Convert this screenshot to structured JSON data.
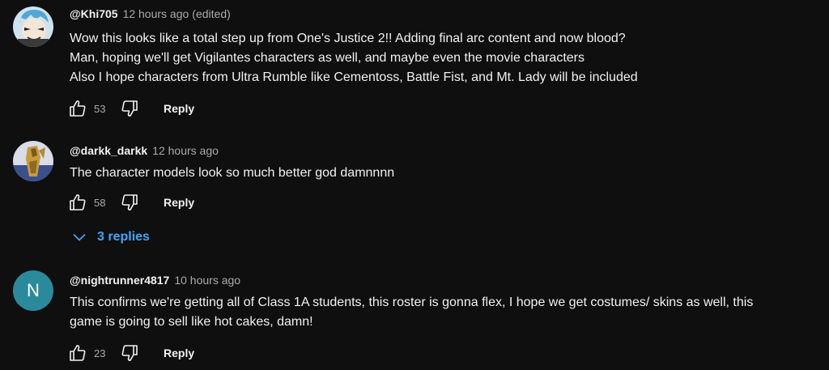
{
  "comments": [
    {
      "author": "@Khi705",
      "time": "12 hours ago",
      "edited": "(edited)",
      "avatar_icon": "anime-character-avatar-icon",
      "lines": [
        "Wow this looks like a total step up from One's Justice 2!! Adding final arc content and now blood?",
        "Man, hoping we'll get Vigilantes characters as well, and maybe even the movie characters",
        "Also I hope characters from Ultra Rumble like Cementoss, Battle Fist, and Mt. Lady will be included"
      ],
      "likes": "53",
      "reply_label": "Reply"
    },
    {
      "author": "@darkk_darkk",
      "time": "12 hours ago",
      "avatar_icon": "gold-figure-avatar-icon",
      "lines": [
        "The character models look so much better god damnnnn"
      ],
      "likes": "58",
      "reply_label": "Reply",
      "replies_label": "3 replies"
    },
    {
      "author": "@nightrunner4817",
      "time": "10 hours ago",
      "avatar_letter": "N",
      "avatar_color": "#2a8a9c",
      "lines": [
        "This confirms we're getting all of Class 1A students, this roster is gonna flex, I hope we get costumes/ skins as well, this",
        "game is going to sell like hot cakes, damn!"
      ],
      "likes": "23",
      "reply_label": "Reply"
    }
  ],
  "colors": {
    "background": "#0f0f0f",
    "text": "#f1f1f1",
    "secondary_text": "#aaaaaa",
    "link_blue": "#3ea6ff"
  }
}
